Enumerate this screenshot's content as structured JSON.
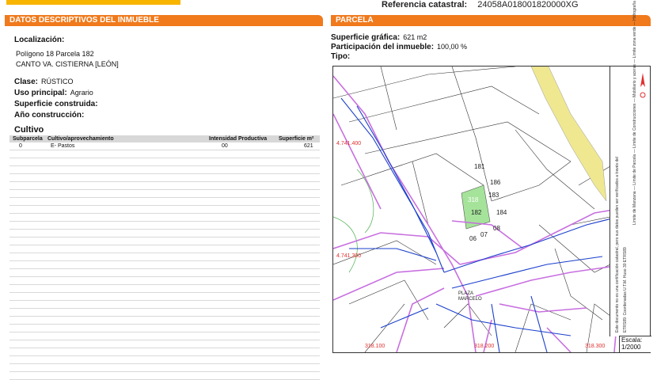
{
  "header": {
    "ref_label": "Referencia catastral:",
    "ref_value": "24058A018001820000XG"
  },
  "left": {
    "section_title": "DATOS DESCRIPTIVOS DEL INMUEBLE",
    "localizacion_label": "Localización:",
    "localizacion_line1": "Polígono 18 Parcela 182",
    "localizacion_line2": "CANTO VA. CISTIERNA [LEÓN]",
    "clase_label": "Clase:",
    "clase_value": "RÚSTICO",
    "uso_label": "Uso principal:",
    "uso_value": "Agrario",
    "superficie_label": "Superficie construida:",
    "anio_label": "Año construcción:",
    "cultivo_title": "Cultivo",
    "table_headers": [
      "Subparcela",
      "Cultivo/aprovechamiento",
      "Intensidad Productiva",
      "Superficie m²"
    ],
    "table_rows": [
      [
        "0",
        "E- Pastos",
        "00",
        "621"
      ]
    ]
  },
  "right": {
    "section_title": "PARCELA",
    "superficie_grafica_label": "Superficie gráfica:",
    "superficie_grafica_value": "621 m2",
    "participacion_label": "Participación del inmueble:",
    "participacion_value": "100,00 %",
    "tipo_label": "Tipo:"
  },
  "map": {
    "parcel_labels": [
      "181",
      "186",
      "183",
      "182",
      "184",
      "08",
      "06",
      "07"
    ],
    "parcel_highlight": "318",
    "plaza_label": "PLAZA MARCELO",
    "coord_labels": [
      "4.741.400",
      "4.741.300",
      "318.100",
      "318.200",
      "318.300"
    ],
    "legend_lines": [
      "Este documento no es una certificación catastral, pero sus datos pueden ser verificados a través del",
      "ETRS89: Coordenadas U.T.M. Huso 30 ETRS89",
      "Límite de Manzana — Límite de Parcela — Límite de Construcciones — Mobiliario y aceras — Límite zona verde — Hidrografía"
    ],
    "escala_label": "Escala:",
    "escala_value": "1/2000"
  },
  "colors": {
    "header_orange": "#f07a1c",
    "top_accent": "#f7b500",
    "parcel_line": "#c86fe0",
    "street_blue": "#1a3fcc",
    "highlight_green": "#a5e39a",
    "road_yellow": "#f0e890"
  }
}
